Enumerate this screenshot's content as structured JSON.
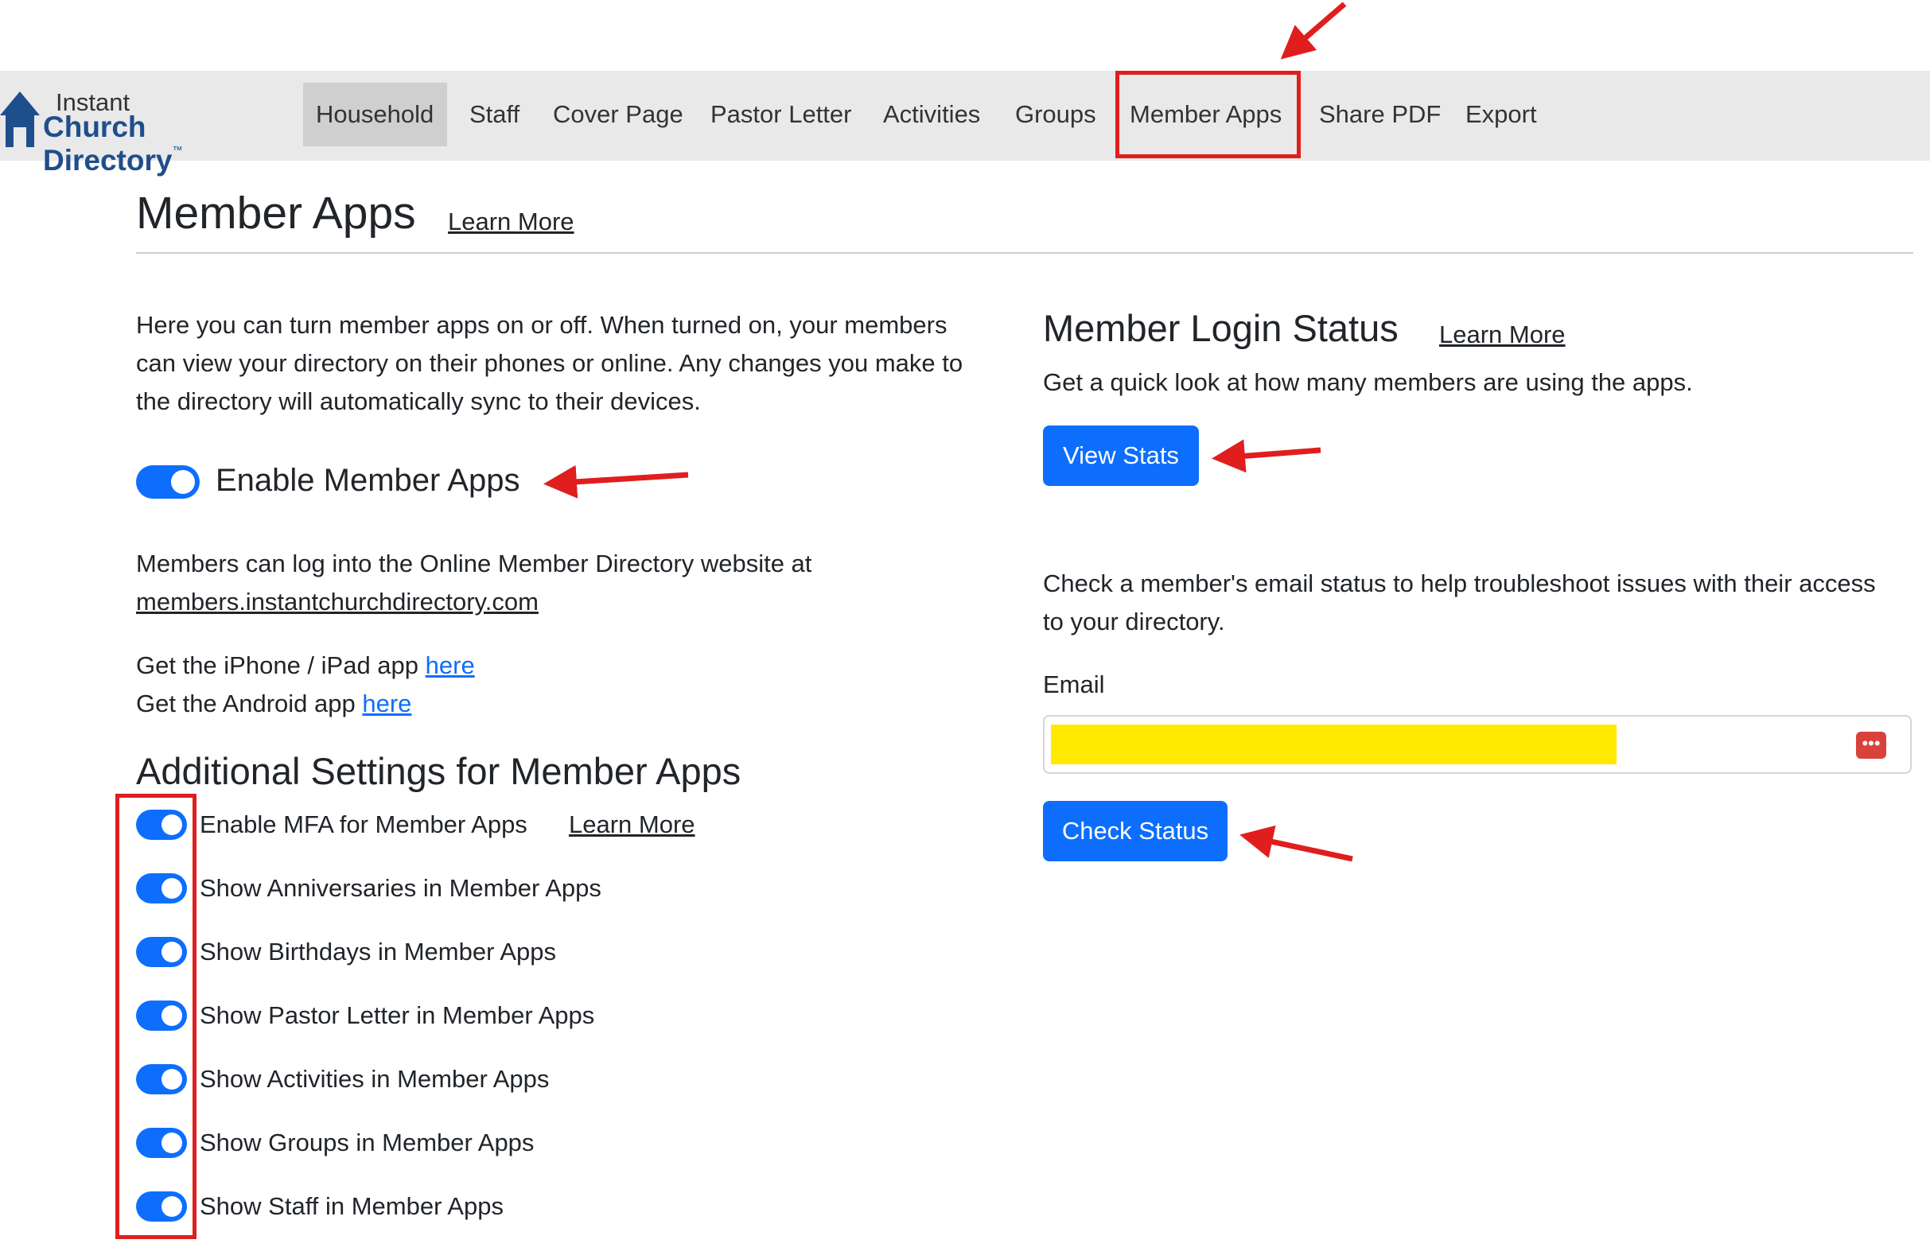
{
  "brand": {
    "line1": "Instant",
    "line2": "Church Directory",
    "tm": "™"
  },
  "nav": [
    {
      "label": "Household",
      "active": true
    },
    {
      "label": "Staff"
    },
    {
      "label": "Cover Page"
    },
    {
      "label": "Pastor Letter"
    },
    {
      "label": "Activities"
    },
    {
      "label": "Groups"
    },
    {
      "label": "Member Apps"
    },
    {
      "label": "Share PDF"
    },
    {
      "label": "Export"
    }
  ],
  "page": {
    "title": "Member Apps",
    "learn_more": "Learn More"
  },
  "left": {
    "intro_lines": [
      "Here you can turn member apps on or off. When turned on, your members",
      "can view your directory on their phones or online. Any changes you make to",
      "the directory will automatically sync to their devices."
    ],
    "enable_label": "Enable Member Apps",
    "enable_on": true,
    "website_text": "Members can log into the Online Member Directory website at",
    "website_link": "members.instantchurchdirectory.com",
    "iphone_text": "Get the iPhone / iPad app ",
    "android_text": "Get the Android app ",
    "here": "here",
    "additional_title": "Additional Settings for Member Apps",
    "settings": [
      {
        "label": "Enable MFA for Member Apps",
        "on": true
      },
      {
        "label": "Show Anniversaries in Member Apps",
        "on": true
      },
      {
        "label": "Show Birthdays in Member Apps",
        "on": true
      },
      {
        "label": "Show Pastor Letter in Member Apps",
        "on": true
      },
      {
        "label": "Show Activities in Member Apps",
        "on": true
      },
      {
        "label": "Show Groups in Member Apps",
        "on": true
      },
      {
        "label": "Show Staff in Member Apps",
        "on": true
      }
    ],
    "mfa_learn_more": "Learn More"
  },
  "right": {
    "login_title": "Member Login Status",
    "learn_more": "Learn More",
    "login_desc": "Get a quick look at how many members are using the apps.",
    "view_stats": "View Stats",
    "email_desc_lines": [
      "Check a member's email status to help troubleshoot issues with their access",
      "to your directory."
    ],
    "email_label": "Email",
    "email_value": "",
    "check_status": "Check Status"
  },
  "colors": {
    "primary": "#0d6efd",
    "annotation": "#e01e1e",
    "highlight": "#ffea00",
    "navbar": "#e9e9e9"
  }
}
